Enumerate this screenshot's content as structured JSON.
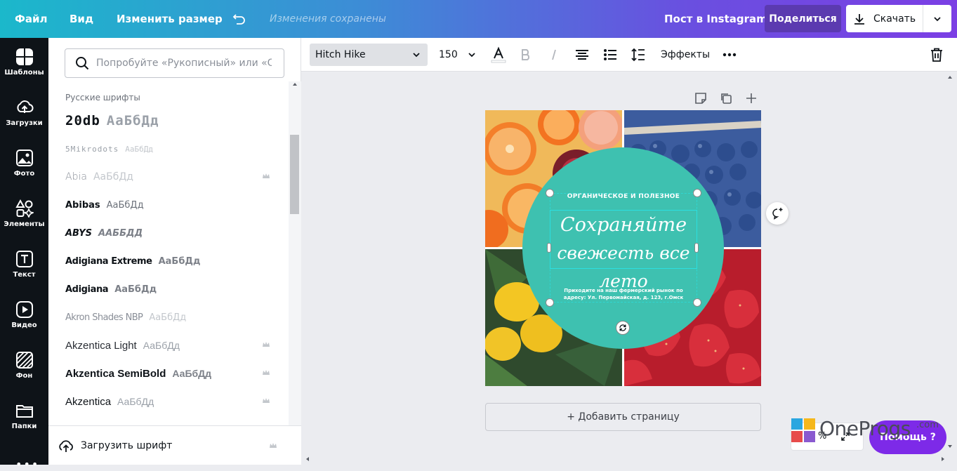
{
  "topbar": {
    "file": "Файл",
    "view": "Вид",
    "resize": "Изменить размер",
    "status": "Изменения сохранены",
    "doc_type": "Пост в Instagram",
    "share": "Поделиться",
    "download": "Скачать"
  },
  "rail": {
    "items": [
      {
        "label": "Шаблоны",
        "icon": "templates-icon"
      },
      {
        "label": "Загрузки",
        "icon": "upload-icon"
      },
      {
        "label": "Фото",
        "icon": "photo-icon"
      },
      {
        "label": "Элементы",
        "icon": "elements-icon"
      },
      {
        "label": "Текст",
        "icon": "text-icon"
      },
      {
        "label": "Видео",
        "icon": "video-icon"
      },
      {
        "label": "Фон",
        "icon": "background-icon"
      },
      {
        "label": "Папки",
        "icon": "folder-icon"
      }
    ]
  },
  "panel": {
    "search_placeholder": "Попробуйте «Рукописный» или «Оре",
    "section_title": "Русские шрифты",
    "fonts": [
      {
        "name": "20db",
        "sample": "АаБбДд",
        "premium": false
      },
      {
        "name": "5Mikrodots",
        "sample": "АаБбДд",
        "premium": false
      },
      {
        "name": "Abia",
        "sample": "АаБбДд",
        "premium": true
      },
      {
        "name": "Abibas",
        "sample": "АаБбДд",
        "premium": false
      },
      {
        "name": "ABYS",
        "sample": "ААББДД",
        "premium": false
      },
      {
        "name": "Adigiana Extreme",
        "sample": "АаБбДд",
        "premium": false
      },
      {
        "name": "Adigiana",
        "sample": "АаБбДд",
        "premium": false
      },
      {
        "name": "Akron Shades NBP",
        "sample": "АаБбДд",
        "premium": false
      },
      {
        "name": "Akzentica Light",
        "sample": "АаБбДд",
        "premium": true
      },
      {
        "name": "Akzentica SemiBold",
        "sample": "АаБбДд",
        "premium": true
      },
      {
        "name": "Akzentica",
        "sample": "АаБбДд",
        "premium": true
      }
    ],
    "upload_font": "Загрузить шрифт"
  },
  "toolbar": {
    "font_family": "Hitch Hike",
    "font_size": "150",
    "effects": "Эффекты"
  },
  "design": {
    "top_text": "ОРГАНИЧЕСКОЕ И ПОЛЕЗНОЕ",
    "title_line1": "Сохраняйте",
    "title_line2": "свежесть все лето",
    "body_line1": "Приходите на наш фермерский рынок по",
    "body_line2": "адресу: Ул. Первомайская, д. 123, г.Омск",
    "circle_color": "#3ec1b0"
  },
  "canvas": {
    "add_page": "+ Добавить страницу"
  },
  "overlay": {
    "help": "Помощь ?",
    "zoom_suffix": "%",
    "watermark": "OneProgs",
    "watermark_suffix": ".com"
  }
}
